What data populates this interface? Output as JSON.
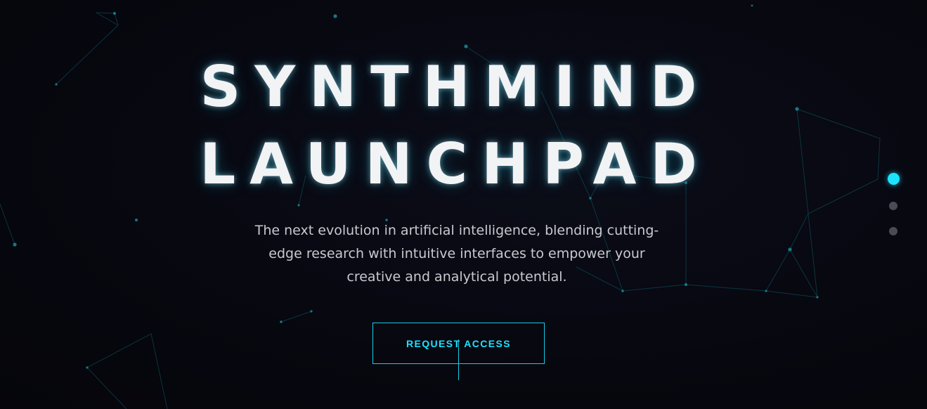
{
  "hero": {
    "title_line1": "SYNTHMIND",
    "title_line2": "LAUNCHPAD",
    "tagline_line1": "The next evolution in artificial intelligence, blending cutting-",
    "tagline_line2": "edge research with intuitive interfaces to empower your",
    "tagline_line3": "creative and analytical potential.",
    "cta_label": "REQUEST ACCESS"
  },
  "slider": {
    "slide_count": 3,
    "active_index": 0
  },
  "colors": {
    "background": "#07070f",
    "accent": "#1ce3ff",
    "title_text": "#f2f3f5",
    "body_text": "#c8cad0",
    "inactive_dot": "#4a4b55",
    "network_line": "#0e5a66"
  },
  "icons": [
    "particle-network-background"
  ]
}
